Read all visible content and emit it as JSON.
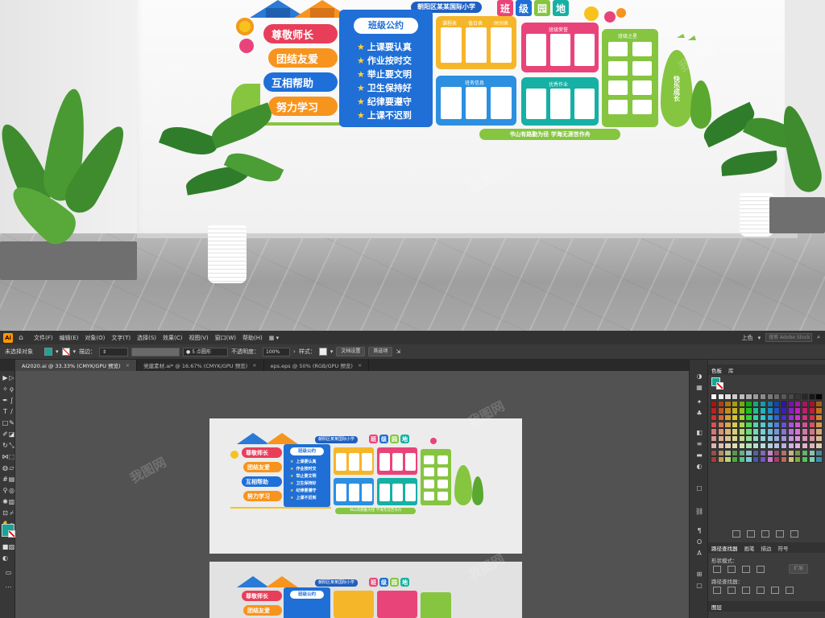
{
  "mockup": {
    "school_name": "朝阳区某某国际小学",
    "wall_title": [
      "班",
      "级",
      "园",
      "地"
    ],
    "values": [
      "尊敬师长",
      "团结友爱",
      "互相帮助",
      "努力学习"
    ],
    "code_title": "班级公约",
    "rules": [
      "上课要认真",
      "作业按时交",
      "举止要文明",
      "卫生保持好",
      "纪律要遵守",
      "上课不迟到"
    ],
    "board_labels": [
      "课程表",
      "值日表",
      "时间表",
      "班级荣誉",
      "班务信息",
      "优秀作业",
      "班级之星"
    ],
    "slogan": "书山有路勤为径 学海无涯苦作舟",
    "leaf_text": "快乐成长"
  },
  "app": {
    "logo": "Ai",
    "menu": [
      "文件(F)",
      "编辑(E)",
      "对象(O)",
      "文字(T)",
      "选择(S)",
      "效果(C)",
      "视图(V)",
      "窗口(W)",
      "帮助(H)"
    ],
    "workspace": "上色",
    "search_placeholder": "搜索 Adobe Stock"
  },
  "controlbar": {
    "selection": "未选择对象",
    "stroke_label": "描边：",
    "brush": "5 点圆形",
    "opacity_label": "不透明度：",
    "opacity_value": "100%",
    "style_label": "样式：",
    "doc_setup": "文档设置",
    "preferences": "首选项"
  },
  "tabs": [
    {
      "label": "AI2020.ai @ 33.33% (CMYK/GPU 预览)",
      "active": true
    },
    {
      "label": "党建素材.ai* @ 16.67% (CMYK/GPU 预览)",
      "active": false
    },
    {
      "label": "eps.eps @ 50% (RGB/GPU 预览)",
      "active": false
    }
  ],
  "panels": {
    "swatches_tabs": [
      "色板",
      "库"
    ],
    "pathfinder_tabs": [
      "路径查找器",
      "画笔",
      "描边",
      "符号"
    ],
    "shape_modes": "形状模式：",
    "expand": "扩展",
    "pathfinders": "路径查找器：",
    "layers": "图层"
  },
  "colors": {
    "accent_teal": "#16a596",
    "ai_orange": "#ff9a00",
    "pill_red": "#e83e5a",
    "pill_orange": "#f7941d",
    "pill_blue": "#1e6fd9",
    "code_blue": "#1f6fd6",
    "board_yellow": "#f6b62a",
    "board_pink": "#e9447a",
    "board_green": "#86c540",
    "board_teal": "#16b0a4",
    "board_blue": "#2c8fe0"
  },
  "watermark": "我图网"
}
